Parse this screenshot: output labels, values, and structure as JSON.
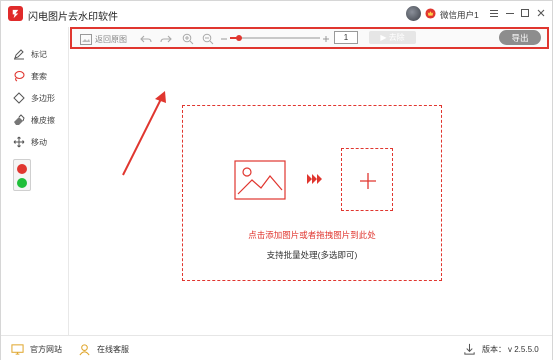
{
  "app": {
    "title": "闪电图片去水印软件",
    "user_name": "微信用户1"
  },
  "window_controls": {
    "menu_icon": "menu-icon",
    "minimize_icon": "minimize-icon",
    "maximize_icon": "maximize-icon",
    "close_icon": "close-icon"
  },
  "toolbar": {
    "back_label": "返回原图",
    "zoom_value": "1",
    "slider_level": 0.1,
    "remove_label": "▶ 去除",
    "export_label": "导出"
  },
  "sidebar": {
    "tools": [
      {
        "icon": "pen-icon",
        "label": "标记",
        "active": false
      },
      {
        "icon": "lasso-icon",
        "label": "套索",
        "active": true
      },
      {
        "icon": "polygon-icon",
        "label": "多边形",
        "active": false
      },
      {
        "icon": "eraser-icon",
        "label": "橡皮擦",
        "active": false
      },
      {
        "icon": "move-icon",
        "label": "移动",
        "active": false
      }
    ],
    "colors": [
      "#e0362f",
      "#1fbf3a"
    ]
  },
  "dropzone": {
    "primary": "点击添加图片或者拖拽图片到此处",
    "secondary": "支持批量处理(多选即可)"
  },
  "footer": {
    "website_label": "官方网站",
    "service_label": "在线客服",
    "version_label": "版本：",
    "version_value": "v 2.5.5.0"
  },
  "colors": {
    "accent": "#e0362f",
    "muted": "#8d8d8d"
  }
}
